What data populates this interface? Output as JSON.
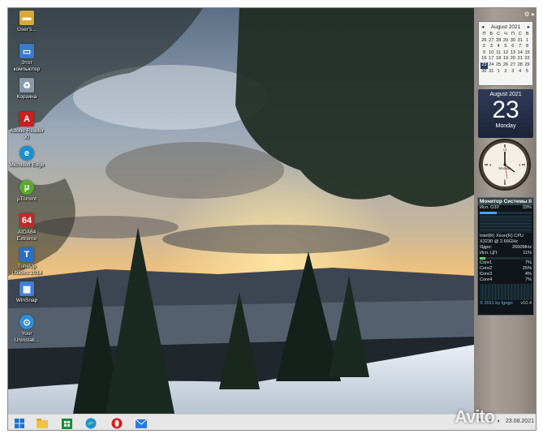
{
  "desktop_icons": [
    {
      "label": "User's...",
      "icon": "folder-icon",
      "color": "#d8a93a"
    },
    {
      "label": "Этот компьютер",
      "icon": "computer-icon",
      "color": "#3b7bc8"
    },
    {
      "label": "Корзина",
      "icon": "recycle-bin-icon",
      "color": "#8a9aa8"
    },
    {
      "label": "Adobe Reader XI",
      "icon": "adobe-reader-icon",
      "color": "#c8201e"
    },
    {
      "label": "Microsoft Edge",
      "icon": "edge-icon",
      "color": "#1a8fd0"
    },
    {
      "label": "µTorrent",
      "icon": "utorrent-icon",
      "color": "#5aa832"
    },
    {
      "label": "AIDA64 Extreme",
      "icon": "aida64-icon",
      "color": "#c02a2a"
    },
    {
      "label": "TuneUp Utilities 2014",
      "icon": "tuneup-icon",
      "color": "#2a6fc4"
    },
    {
      "label": "WinSnap",
      "icon": "winsnap-icon",
      "color": "#3f7fd8"
    },
    {
      "label": "Your Uninstall...",
      "icon": "uninstaller-icon",
      "color": "#2f8fd8"
    }
  ],
  "calendar": {
    "month_title": "August 2021",
    "weekdays": [
      "П",
      "В",
      "С",
      "Ч",
      "П",
      "С",
      "В"
    ],
    "days": [
      "26",
      "27",
      "28",
      "29",
      "30",
      "31",
      "1",
      "2",
      "3",
      "4",
      "5",
      "6",
      "7",
      "8",
      "9",
      "10",
      "11",
      "12",
      "13",
      "14",
      "15",
      "16",
      "17",
      "18",
      "19",
      "20",
      "21",
      "22",
      "23",
      "24",
      "25",
      "26",
      "27",
      "28",
      "29",
      "30",
      "31",
      "1",
      "2",
      "3",
      "4",
      "5"
    ],
    "highlight": "23",
    "day_month": "August 2021",
    "day_number": "23",
    "day_weekday": "Monday"
  },
  "clock": {
    "city": "Москва"
  },
  "system_monitor": {
    "title": "Монитор Системы II",
    "ram_label": "Исп. ОЗУ",
    "ram_percent": "33%",
    "ram_fill": 0.33,
    "cpu_label": "Intel(R) Xeon(R) CPU",
    "cpu_model": "X3230 @ 2.66GHz",
    "cores_label": "Ядро:",
    "cores_freq": "2660MHz",
    "cpu_use_label": "Исп. ЦП",
    "cpu_use_percent": "11%",
    "cpu_fill": 0.11,
    "core_rows": [
      {
        "label": "Core1",
        "value": "7%"
      },
      {
        "label": "Core2",
        "value": "25%"
      },
      {
        "label": "Core3",
        "value": "4%"
      },
      {
        "label": "Core4",
        "value": "7%"
      }
    ],
    "footer": "© 2011 by Igogo",
    "version": "v10.4"
  },
  "taskbar": {
    "apps": [
      {
        "name": "start-button",
        "icon": "windows-icon"
      },
      {
        "name": "file-explorer",
        "icon": "folder-icon"
      },
      {
        "name": "store",
        "icon": "store-icon"
      },
      {
        "name": "edge",
        "icon": "edge-icon"
      },
      {
        "name": "opera",
        "icon": "opera-icon"
      },
      {
        "name": "mail",
        "icon": "mail-icon"
      }
    ],
    "time": "23.08.2021"
  },
  "watermark": "Avito",
  "colors": {
    "taskbar_bg": "#e7e7e7",
    "accent": "#2a3e66"
  }
}
